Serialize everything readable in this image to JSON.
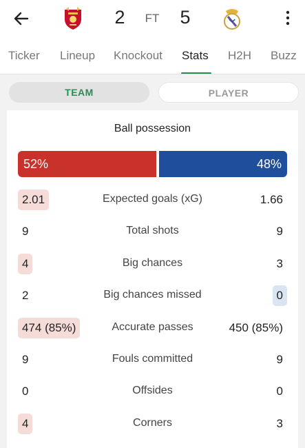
{
  "colors": {
    "home": "#c9322b",
    "away": "#1f4e9c",
    "accent": "#1e8e4e",
    "home_highlight": "#f6dcd9",
    "away_highlight": "#dbe5f2"
  },
  "header": {
    "back_icon": "arrow-left-icon",
    "home_crest": "liverpool-crest-icon",
    "away_crest": "real-madrid-crest-icon",
    "home_score": "2",
    "status": "FT",
    "away_score": "5",
    "menu_icon": "more-vertical-icon"
  },
  "tabs": [
    {
      "label": "Ticker",
      "active": false
    },
    {
      "label": "Lineup",
      "active": false
    },
    {
      "label": "Knockout",
      "active": false
    },
    {
      "label": "Stats",
      "active": true
    },
    {
      "label": "H2H",
      "active": false
    },
    {
      "label": "Buzz",
      "active": false
    }
  ],
  "toggle": {
    "team": "TEAM",
    "player": "PLAYER",
    "selected": "team"
  },
  "possession": {
    "title": "Ball possession",
    "home": "52%",
    "away": "48%",
    "home_value": 52,
    "away_value": 48
  },
  "stats": [
    {
      "label": "Expected goals (xG)",
      "home": "2.01",
      "away": "1.66",
      "highlight": "home"
    },
    {
      "label": "Total shots",
      "home": "9",
      "away": "9",
      "highlight": "none"
    },
    {
      "label": "Big chances",
      "home": "4",
      "away": "3",
      "highlight": "home"
    },
    {
      "label": "Big chances missed",
      "home": "2",
      "away": "0",
      "highlight": "away"
    },
    {
      "label": "Accurate passes",
      "home": "474 (85%)",
      "away": "450 (85%)",
      "highlight": "home"
    },
    {
      "label": "Fouls committed",
      "home": "9",
      "away": "9",
      "highlight": "none"
    },
    {
      "label": "Offsides",
      "home": "0",
      "away": "0",
      "highlight": "none"
    },
    {
      "label": "Corners",
      "home": "4",
      "away": "3",
      "highlight": "home"
    }
  ]
}
